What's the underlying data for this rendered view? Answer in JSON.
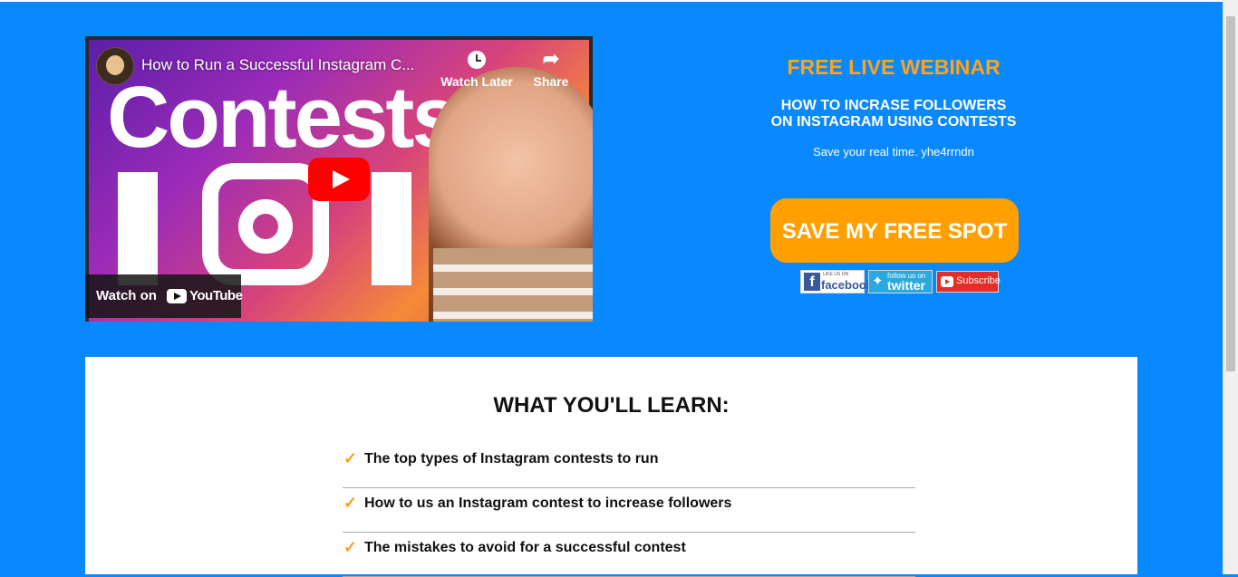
{
  "video": {
    "title": "How to Run a Successful Instagram C...",
    "thumbnail_text": "Contests",
    "watch_later_label": "Watch Later",
    "share_label": "Share",
    "watch_on_label": "Watch on",
    "youtube_label": "YouTube"
  },
  "promo": {
    "eyebrow": "FREE LIVE WEBINAR",
    "headline_line1": "HOW TO INCRASE FOLLOWERS",
    "headline_line2": "ON INSTAGRAM USING CONTESTS",
    "subtext": "Save your real time. yhe4rrndn",
    "cta_label": "SAVE MY FREE SPOT",
    "social": {
      "facebook_small": "LIKE US ON",
      "facebook_word": "facebook",
      "twitter_small": "follow us on",
      "twitter_word": "twitter",
      "youtube_word": "Subscribe"
    }
  },
  "learn": {
    "title": "WHAT YOU'LL LEARN:",
    "check_glyph": "✓",
    "items": [
      "The top types of Instagram contests to run",
      "How to us an Instagram contest to increase followers",
      "The mistakes to avoid for a successful contest"
    ]
  },
  "colors": {
    "background": "#0a88fd",
    "accent_orange": "#ffa31a",
    "cta": "#ffa000",
    "youtube_red": "#ff0000"
  }
}
